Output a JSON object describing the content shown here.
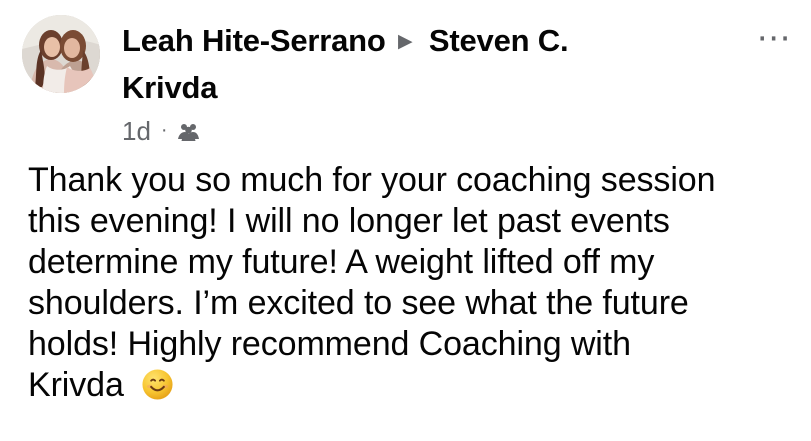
{
  "post": {
    "author": "Leah Hite-Serrano",
    "arrow": "▶",
    "recipient_first_line": "Steven C.",
    "recipient_second_line": "Krivda",
    "timestamp": "1d",
    "meta_separator": "·",
    "audience_icon": "friends-icon",
    "more_icon": "more-options-icon",
    "body_lines": [
      "Thank you so much for your coaching session",
      "this evening! I will no longer let past events",
      "determine my future! A weight lifted off my",
      "shoulders. I’m excited to see what the future",
      "holds! Highly recommend Coaching with",
      "Krivda"
    ],
    "emoji": "smiling-face-icon"
  },
  "colors": {
    "text": "#050505",
    "secondary_text": "#65676b",
    "background": "#ffffff",
    "emoji_yellow": "#f7c531"
  }
}
